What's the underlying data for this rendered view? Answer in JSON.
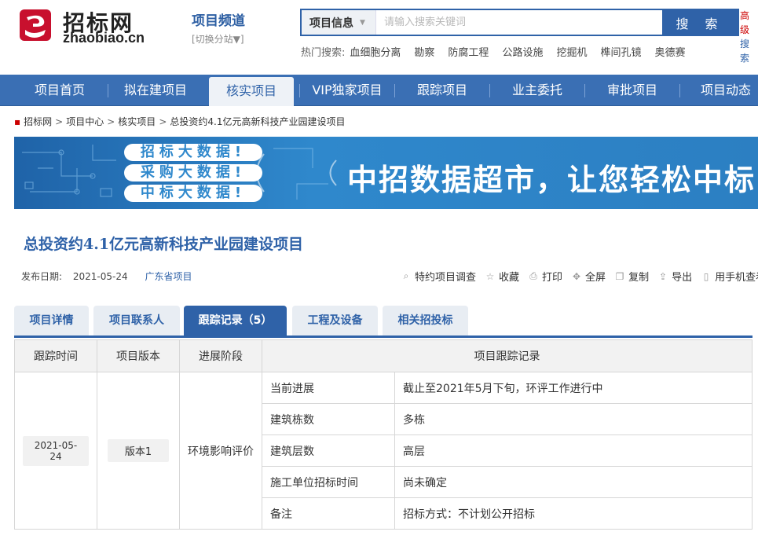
{
  "header": {
    "logo_cn": "招标网",
    "logo_en": "zhaobiao.cn",
    "channel_title": "项目频道",
    "channel_switch": "[切换分站▼]"
  },
  "search": {
    "category": "项目信息",
    "placeholder": "请输入搜索关键词",
    "button": "搜 索",
    "advanced_top": "高级",
    "advanced_bottom": "搜索"
  },
  "hot": {
    "label": "热门搜索:",
    "items": [
      "血细胞分离",
      "勘察",
      "防腐工程",
      "公路设施",
      "挖掘机",
      "榫间孔镜",
      "奥德赛"
    ]
  },
  "nav": {
    "items": [
      "项目首页",
      "拟在建项目",
      "核实项目",
      "VIP独家项目",
      "跟踪项目",
      "业主委托",
      "审批项目",
      "项目动态"
    ],
    "active_index": 2
  },
  "breadcrumb": [
    "招标网",
    "项目中心",
    "核实项目",
    "总投资约4.1亿元高新科技产业园建设项目"
  ],
  "banner": {
    "pills": [
      "招标大数据!",
      "采购大数据!",
      "中标大数据!"
    ],
    "headline": "中招数据超市，让您轻松中标"
  },
  "project": {
    "title": "总投资约4.1亿元高新科技产业园建设项目",
    "publish_label": "发布日期:",
    "publish_date": "2021-05-24",
    "province": "广东省项目"
  },
  "tools": [
    {
      "icon": "search-icon",
      "label": "特约项目调查"
    },
    {
      "icon": "star-icon",
      "label": "收藏"
    },
    {
      "icon": "printer-icon",
      "label": "打印"
    },
    {
      "icon": "fullscreen-icon",
      "label": "全屏"
    },
    {
      "icon": "copy-icon",
      "label": "复制"
    },
    {
      "icon": "export-icon",
      "label": "导出"
    },
    {
      "icon": "phone-icon",
      "label": "用手机查看"
    }
  ],
  "tabs": [
    "项目详情",
    "项目联系人",
    "跟踪记录（5）",
    "工程及设备",
    "相关招投标"
  ],
  "tabs_active_index": 2,
  "table": {
    "headers": [
      "跟踪时间",
      "项目版本",
      "进展阶段",
      "项目跟踪记录"
    ],
    "date": "2021-05-24",
    "version": "版本1",
    "stage": "环境影响评价",
    "records": [
      {
        "key": "当前进展",
        "value": "截止至2021年5月下旬，环评工作进行中"
      },
      {
        "key": "建筑栋数",
        "value": "多栋"
      },
      {
        "key": "建筑层数",
        "value": "高层"
      },
      {
        "key": "施工单位招标时间",
        "value": "尚未确定"
      },
      {
        "key": "备注",
        "value": "招标方式：不计划公开招标"
      }
    ]
  },
  "colors": {
    "brand_blue": "#2f62a8",
    "nav_blue": "#3a6fb4",
    "logo_red": "#c8102e"
  }
}
